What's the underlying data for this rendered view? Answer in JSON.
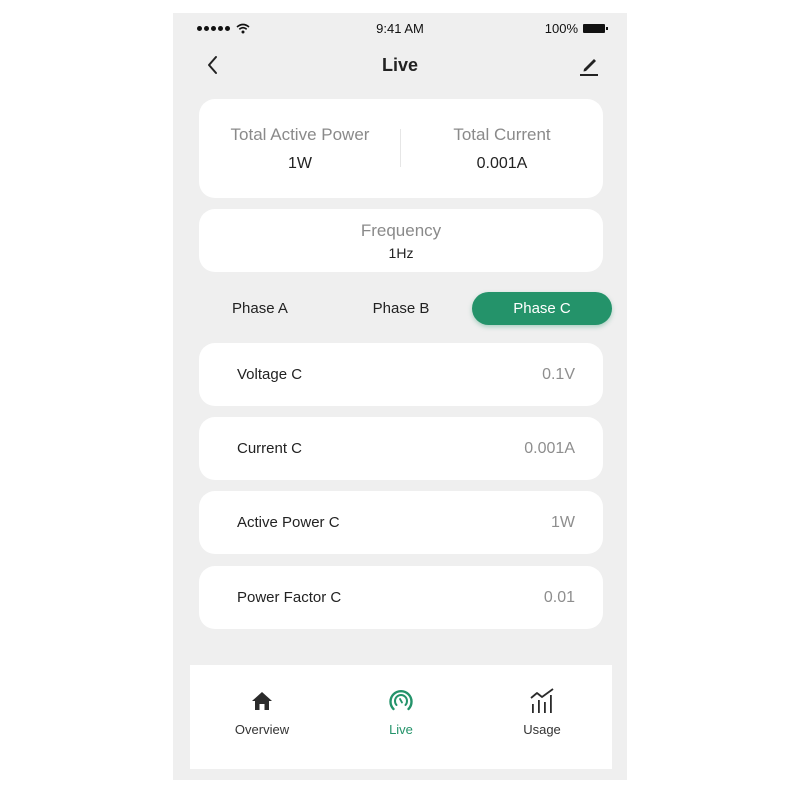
{
  "status_bar": {
    "time": "9:41 AM",
    "battery": "100%",
    "signal_icon": "signal-dots-icon",
    "wifi_icon": "wifi-icon",
    "battery_icon": "battery-icon"
  },
  "header": {
    "title": "Live",
    "back_icon": "chevron-left-icon",
    "edit_icon": "pencil-icon"
  },
  "totals": {
    "active_power_label": "Total Active Power",
    "active_power_value": "1W",
    "current_label": "Total Current",
    "current_value": "0.001A"
  },
  "frequency": {
    "label": "Frequency",
    "value": "1Hz"
  },
  "phase_tabs": [
    {
      "label": "Phase A",
      "active": false
    },
    {
      "label": "Phase B",
      "active": false
    },
    {
      "label": "Phase C",
      "active": true
    }
  ],
  "measurements": [
    {
      "label": "Voltage C",
      "value": "0.1V"
    },
    {
      "label": "Current C",
      "value": "0.001A"
    },
    {
      "label": "Active Power C",
      "value": "1W"
    },
    {
      "label": "Power Factor C",
      "value": "0.01"
    }
  ],
  "bottom_nav": [
    {
      "label": "Overview",
      "icon": "home-icon",
      "active": false
    },
    {
      "label": "Live",
      "icon": "gauge-icon",
      "active": true
    },
    {
      "label": "Usage",
      "icon": "chart-icon",
      "active": false
    }
  ],
  "colors": {
    "accent": "#24936a",
    "background": "#efefef",
    "card": "#ffffff"
  }
}
